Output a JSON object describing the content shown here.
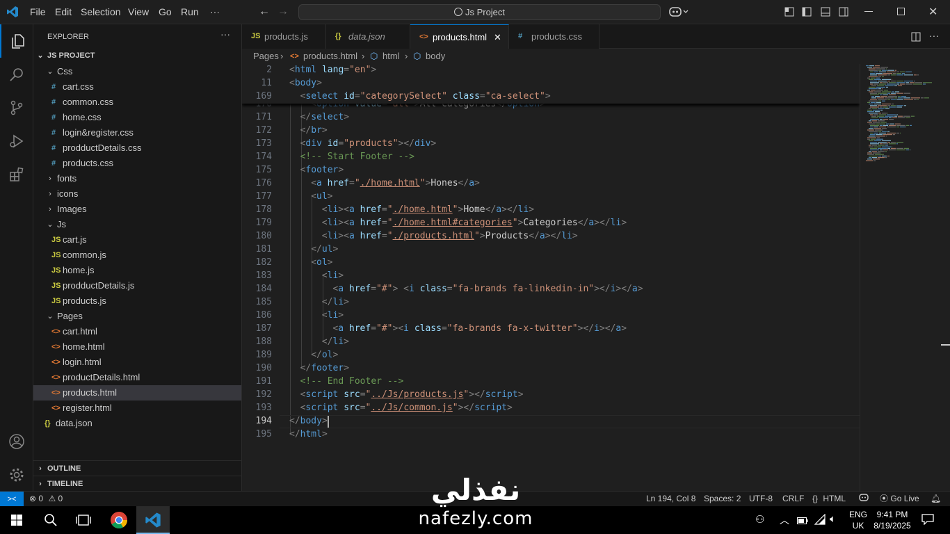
{
  "menu": [
    "File",
    "Edit",
    "Selection",
    "View",
    "Go",
    "Run",
    "···"
  ],
  "command_center": "Js Project",
  "explorer": {
    "title": "EXPLORER",
    "project": "JS PROJECT",
    "tree": [
      {
        "label": "Css",
        "kind": "folder-open",
        "depth": 1
      },
      {
        "label": "cart.css",
        "kind": "css",
        "depth": 2
      },
      {
        "label": "common.css",
        "kind": "css",
        "depth": 2
      },
      {
        "label": "home.css",
        "kind": "css",
        "depth": 2
      },
      {
        "label": "login&register.css",
        "kind": "css",
        "depth": 2
      },
      {
        "label": "prodductDetails.css",
        "kind": "css",
        "depth": 2
      },
      {
        "label": "products.css",
        "kind": "css",
        "depth": 2
      },
      {
        "label": "fonts",
        "kind": "folder",
        "depth": 1
      },
      {
        "label": "icons",
        "kind": "folder",
        "depth": 1
      },
      {
        "label": "Images",
        "kind": "folder",
        "depth": 1
      },
      {
        "label": "Js",
        "kind": "folder-open",
        "depth": 1
      },
      {
        "label": "cart.js",
        "kind": "js",
        "depth": 2
      },
      {
        "label": "common.js",
        "kind": "js",
        "depth": 2
      },
      {
        "label": "home.js",
        "kind": "js",
        "depth": 2
      },
      {
        "label": "prodductDetails.js",
        "kind": "js",
        "depth": 2
      },
      {
        "label": "products.js",
        "kind": "js",
        "depth": 2
      },
      {
        "label": "Pages",
        "kind": "folder-open",
        "depth": 1
      },
      {
        "label": "cart.html",
        "kind": "html",
        "depth": 2
      },
      {
        "label": "home.html",
        "kind": "html",
        "depth": 2
      },
      {
        "label": "login.html",
        "kind": "html",
        "depth": 2
      },
      {
        "label": "productDetails.html",
        "kind": "html",
        "depth": 2
      },
      {
        "label": "products.html",
        "kind": "html",
        "depth": 2,
        "selected": true
      },
      {
        "label": "register.html",
        "kind": "html",
        "depth": 2
      },
      {
        "label": "data.json",
        "kind": "json",
        "depth": 1
      }
    ],
    "outline": "OUTLINE",
    "timeline": "TIMELINE"
  },
  "tabs": [
    {
      "label": "products.js",
      "icon": "JS",
      "kind": "js",
      "italic": false
    },
    {
      "label": "data.json",
      "icon": "{}",
      "kind": "json",
      "italic": true
    },
    {
      "label": "products.html",
      "icon": "<>",
      "kind": "html",
      "active": true
    },
    {
      "label": "products.css",
      "icon": "#",
      "kind": "css"
    }
  ],
  "breadcrumb": [
    "Pages",
    "products.html",
    "html",
    "body"
  ],
  "sticky_lines": [
    {
      "num": "2",
      "tokens": [
        [
          "t",
          "<"
        ],
        [
          "tag",
          "html"
        ],
        [
          "t",
          " "
        ],
        [
          "attr",
          "lang"
        ],
        [
          "t",
          "="
        ],
        [
          "str",
          "\"en\""
        ],
        [
          "t",
          ">"
        ]
      ],
      "indent": 0
    },
    {
      "num": "11",
      "tokens": [
        [
          "t",
          "<"
        ],
        [
          "tag",
          "body"
        ],
        [
          "t",
          ">"
        ]
      ],
      "indent": 0
    },
    {
      "num": "169",
      "tokens": [
        [
          "t",
          "<"
        ],
        [
          "tag",
          "select"
        ],
        [
          "t",
          " "
        ],
        [
          "attr",
          "id"
        ],
        [
          "t",
          "="
        ],
        [
          "str",
          "\"categorySelect\""
        ],
        [
          "t",
          " "
        ],
        [
          "attr",
          "class"
        ],
        [
          "t",
          "="
        ],
        [
          "str",
          "\"ca-select\""
        ],
        [
          "t",
          ">"
        ]
      ],
      "indent": 1
    }
  ],
  "code_lines": [
    {
      "num": "170",
      "tokens": [
        [
          "t",
          "<"
        ],
        [
          "tag",
          "option"
        ],
        [
          "t",
          " "
        ],
        [
          "attr",
          "value"
        ],
        [
          "t",
          "="
        ],
        [
          "str",
          "\"all\""
        ],
        [
          "t",
          ">"
        ],
        [
          "txt",
          "All Categories"
        ],
        [
          "t",
          "</"
        ],
        [
          "tag",
          "option"
        ],
        [
          "t",
          ">"
        ]
      ],
      "indent": 2
    },
    {
      "num": "171",
      "tokens": [
        [
          "t",
          "</"
        ],
        [
          "tag",
          "select"
        ],
        [
          "t",
          ">"
        ]
      ],
      "indent": 1
    },
    {
      "num": "172",
      "tokens": [
        [
          "t",
          "</"
        ],
        [
          "tag",
          "br"
        ],
        [
          "t",
          ">"
        ]
      ],
      "indent": 1
    },
    {
      "num": "173",
      "tokens": [
        [
          "t",
          "<"
        ],
        [
          "tag",
          "div"
        ],
        [
          "t",
          " "
        ],
        [
          "attr",
          "id"
        ],
        [
          "t",
          "="
        ],
        [
          "str",
          "\"products\""
        ],
        [
          "t",
          "></"
        ],
        [
          "tag",
          "div"
        ],
        [
          "t",
          ">"
        ]
      ],
      "indent": 1
    },
    {
      "num": "174",
      "tokens": [
        [
          "cmt",
          "<!-- Start Footer -->"
        ]
      ],
      "indent": 1
    },
    {
      "num": "175",
      "tokens": [
        [
          "t",
          "<"
        ],
        [
          "tag",
          "footer"
        ],
        [
          "t",
          ">"
        ]
      ],
      "indent": 1
    },
    {
      "num": "176",
      "tokens": [
        [
          "t",
          "<"
        ],
        [
          "tag",
          "a"
        ],
        [
          "t",
          " "
        ],
        [
          "attr",
          "href"
        ],
        [
          "t",
          "="
        ],
        [
          "str",
          "\""
        ],
        [
          "link",
          "./home.html"
        ],
        [
          "str",
          "\""
        ],
        [
          "t",
          ">"
        ],
        [
          "txt",
          "Hones"
        ],
        [
          "t",
          "</"
        ],
        [
          "tag",
          "a"
        ],
        [
          "t",
          ">"
        ]
      ],
      "indent": 2
    },
    {
      "num": "177",
      "tokens": [
        [
          "t",
          "<"
        ],
        [
          "tag",
          "ul"
        ],
        [
          "t",
          ">"
        ]
      ],
      "indent": 2
    },
    {
      "num": "178",
      "tokens": [
        [
          "t",
          "<"
        ],
        [
          "tag",
          "li"
        ],
        [
          "t",
          "><"
        ],
        [
          "tag",
          "a"
        ],
        [
          "t",
          " "
        ],
        [
          "attr",
          "href"
        ],
        [
          "t",
          "="
        ],
        [
          "str",
          "\""
        ],
        [
          "link",
          "./home.html"
        ],
        [
          "str",
          "\""
        ],
        [
          "t",
          ">"
        ],
        [
          "txt",
          "Home"
        ],
        [
          "t",
          "</"
        ],
        [
          "tag",
          "a"
        ],
        [
          "t",
          "></"
        ],
        [
          "tag",
          "li"
        ],
        [
          "t",
          ">"
        ]
      ],
      "indent": 3
    },
    {
      "num": "179",
      "tokens": [
        [
          "t",
          "<"
        ],
        [
          "tag",
          "li"
        ],
        [
          "t",
          "><"
        ],
        [
          "tag",
          "a"
        ],
        [
          "t",
          " "
        ],
        [
          "attr",
          "href"
        ],
        [
          "t",
          "="
        ],
        [
          "str",
          "\""
        ],
        [
          "link",
          "./home.html#categories"
        ],
        [
          "str",
          "\""
        ],
        [
          "t",
          ">"
        ],
        [
          "txt",
          "Categories"
        ],
        [
          "t",
          "</"
        ],
        [
          "tag",
          "a"
        ],
        [
          "t",
          "></"
        ],
        [
          "tag",
          "li"
        ],
        [
          "t",
          ">"
        ]
      ],
      "indent": 3
    },
    {
      "num": "180",
      "tokens": [
        [
          "t",
          "<"
        ],
        [
          "tag",
          "li"
        ],
        [
          "t",
          "><"
        ],
        [
          "tag",
          "a"
        ],
        [
          "t",
          " "
        ],
        [
          "attr",
          "href"
        ],
        [
          "t",
          "="
        ],
        [
          "str",
          "\""
        ],
        [
          "link",
          "./products.html"
        ],
        [
          "str",
          "\""
        ],
        [
          "t",
          ">"
        ],
        [
          "txt",
          "Products"
        ],
        [
          "t",
          "</"
        ],
        [
          "tag",
          "a"
        ],
        [
          "t",
          "></"
        ],
        [
          "tag",
          "li"
        ],
        [
          "t",
          ">"
        ]
      ],
      "indent": 3
    },
    {
      "num": "181",
      "tokens": [
        [
          "t",
          "</"
        ],
        [
          "tag",
          "ul"
        ],
        [
          "t",
          ">"
        ]
      ],
      "indent": 2
    },
    {
      "num": "182",
      "tokens": [
        [
          "t",
          "<"
        ],
        [
          "tag",
          "ol"
        ],
        [
          "t",
          ">"
        ]
      ],
      "indent": 2
    },
    {
      "num": "183",
      "tokens": [
        [
          "t",
          "<"
        ],
        [
          "tag",
          "li"
        ],
        [
          "t",
          ">"
        ]
      ],
      "indent": 3
    },
    {
      "num": "184",
      "tokens": [
        [
          "t",
          "<"
        ],
        [
          "tag",
          "a"
        ],
        [
          "t",
          " "
        ],
        [
          "attr",
          "href"
        ],
        [
          "t",
          "="
        ],
        [
          "str",
          "\"#\""
        ],
        [
          "t",
          "> <"
        ],
        [
          "tag",
          "i"
        ],
        [
          "t",
          " "
        ],
        [
          "attr",
          "class"
        ],
        [
          "t",
          "="
        ],
        [
          "str",
          "\"fa-brands fa-linkedin-in\""
        ],
        [
          "t",
          "></"
        ],
        [
          "tag",
          "i"
        ],
        [
          "t",
          "></"
        ],
        [
          "tag",
          "a"
        ],
        [
          "t",
          ">"
        ]
      ],
      "indent": 4
    },
    {
      "num": "185",
      "tokens": [
        [
          "t",
          "</"
        ],
        [
          "tag",
          "li"
        ],
        [
          "t",
          ">"
        ]
      ],
      "indent": 3
    },
    {
      "num": "186",
      "tokens": [
        [
          "t",
          "<"
        ],
        [
          "tag",
          "li"
        ],
        [
          "t",
          ">"
        ]
      ],
      "indent": 3
    },
    {
      "num": "187",
      "tokens": [
        [
          "t",
          "<"
        ],
        [
          "tag",
          "a"
        ],
        [
          "t",
          " "
        ],
        [
          "attr",
          "href"
        ],
        [
          "t",
          "="
        ],
        [
          "str",
          "\"#\""
        ],
        [
          "t",
          "><"
        ],
        [
          "tag",
          "i"
        ],
        [
          "t",
          " "
        ],
        [
          "attr",
          "class"
        ],
        [
          "t",
          "="
        ],
        [
          "str",
          "\"fa-brands fa-x-twitter\""
        ],
        [
          "t",
          "></"
        ],
        [
          "tag",
          "i"
        ],
        [
          "t",
          "></"
        ],
        [
          "tag",
          "a"
        ],
        [
          "t",
          ">"
        ]
      ],
      "indent": 4
    },
    {
      "num": "188",
      "tokens": [
        [
          "t",
          "</"
        ],
        [
          "tag",
          "li"
        ],
        [
          "t",
          ">"
        ]
      ],
      "indent": 3
    },
    {
      "num": "189",
      "tokens": [
        [
          "t",
          "</"
        ],
        [
          "tag",
          "ol"
        ],
        [
          "t",
          ">"
        ]
      ],
      "indent": 2
    },
    {
      "num": "190",
      "tokens": [
        [
          "t",
          "</"
        ],
        [
          "tag",
          "footer"
        ],
        [
          "t",
          ">"
        ]
      ],
      "indent": 1
    },
    {
      "num": "191",
      "tokens": [
        [
          "cmt",
          "<!-- End Footer -->"
        ]
      ],
      "indent": 1
    },
    {
      "num": "192",
      "tokens": [
        [
          "t",
          "<"
        ],
        [
          "tag",
          "script"
        ],
        [
          "t",
          " "
        ],
        [
          "attr",
          "src"
        ],
        [
          "t",
          "="
        ],
        [
          "str",
          "\""
        ],
        [
          "link",
          "../Js/products.js"
        ],
        [
          "str",
          "\""
        ],
        [
          "t",
          "></"
        ],
        [
          "tag",
          "script"
        ],
        [
          "t",
          ">"
        ]
      ],
      "indent": 1
    },
    {
      "num": "193",
      "tokens": [
        [
          "t",
          "<"
        ],
        [
          "tag",
          "script"
        ],
        [
          "t",
          " "
        ],
        [
          "attr",
          "src"
        ],
        [
          "t",
          "="
        ],
        [
          "str",
          "\""
        ],
        [
          "link",
          "../Js/common.js"
        ],
        [
          "str",
          "\""
        ],
        [
          "t",
          "></"
        ],
        [
          "tag",
          "script"
        ],
        [
          "t",
          ">"
        ]
      ],
      "indent": 1
    },
    {
      "num": "194",
      "tokens": [
        [
          "t",
          "</"
        ],
        [
          "tag",
          "body"
        ],
        [
          "t",
          ">"
        ]
      ],
      "indent": 0,
      "current": true
    },
    {
      "num": "195",
      "tokens": [
        [
          "t",
          "</"
        ],
        [
          "tag",
          "html"
        ],
        [
          "t",
          ">"
        ]
      ],
      "indent": 0
    }
  ],
  "status": {
    "errors": "0",
    "warnings": "0",
    "position": "Ln 194, Col 8",
    "spaces": "Spaces: 2",
    "encoding": "UTF-8",
    "eol": "CRLF",
    "language": "HTML",
    "golive": "Go Live"
  },
  "taskbar": {
    "lang_top": "ENG",
    "lang_bottom": "UK",
    "time": "9:41 PM",
    "date": "8/19/2025"
  },
  "watermark": {
    "arabic": "نفذلي",
    "latin": "nafezly.com"
  },
  "colors": {
    "accent": "#0078d4",
    "tag": "#569cd6",
    "attr": "#9cdcfe",
    "str": "#ce9178",
    "comment": "#6a9955",
    "css_icon": "#519aba",
    "js_icon": "#cbcb41",
    "html_icon": "#e37933",
    "json_icon": "#cbcb41"
  }
}
